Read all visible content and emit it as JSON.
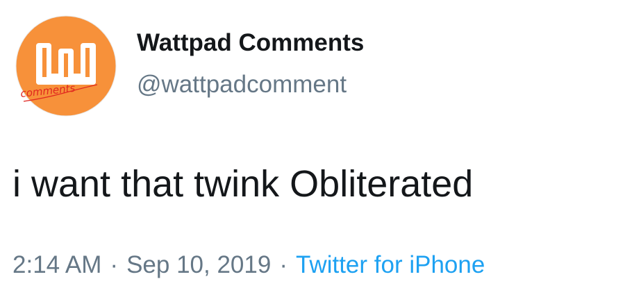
{
  "tweet": {
    "author": {
      "display_name": "Wattpad Comments",
      "handle": "@wattpadcomment",
      "avatar": {
        "icon": "wattpad-comments-logo-icon",
        "logo_text": "comments"
      }
    },
    "text": "i want that twink Obliterated",
    "time": "2:14 AM",
    "date": "Sep 10, 2019",
    "separator": "·",
    "source": "Twitter for iPhone"
  },
  "colors": {
    "avatar_orange": "#f7913a",
    "logo_red": "#e0261f",
    "secondary_text": "#657786",
    "link_blue": "#1da1f2"
  }
}
